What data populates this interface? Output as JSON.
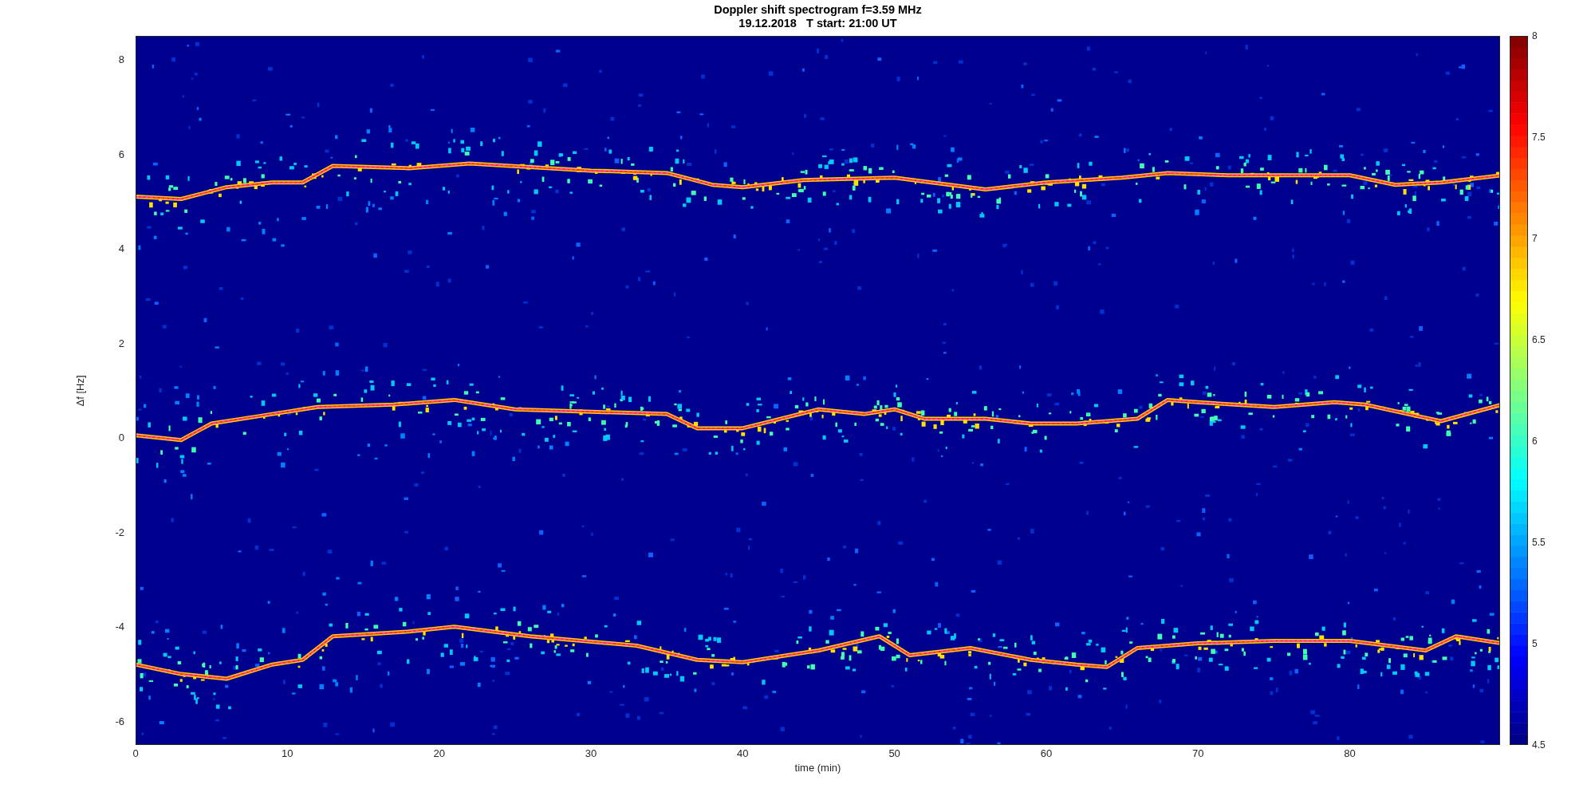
{
  "figure": {
    "title": "Doppler shift spectrogram f=3.59 MHz",
    "subtitle": "19.12.2018   T start: 21:00 UT",
    "xlabel": "time (min)",
    "ylabel": "Δf [Hz]",
    "xticks": [
      "0",
      "10",
      "20",
      "30",
      "40",
      "50",
      "60",
      "70",
      "80"
    ],
    "yticks": [
      "8",
      "6",
      "4",
      "2",
      "0",
      "-2",
      "-4",
      "-6"
    ],
    "colorbar_ticks": [
      "8",
      "7.5",
      "7",
      "6.5",
      "6",
      "5.5",
      "5",
      "4.5"
    ]
  }
}
